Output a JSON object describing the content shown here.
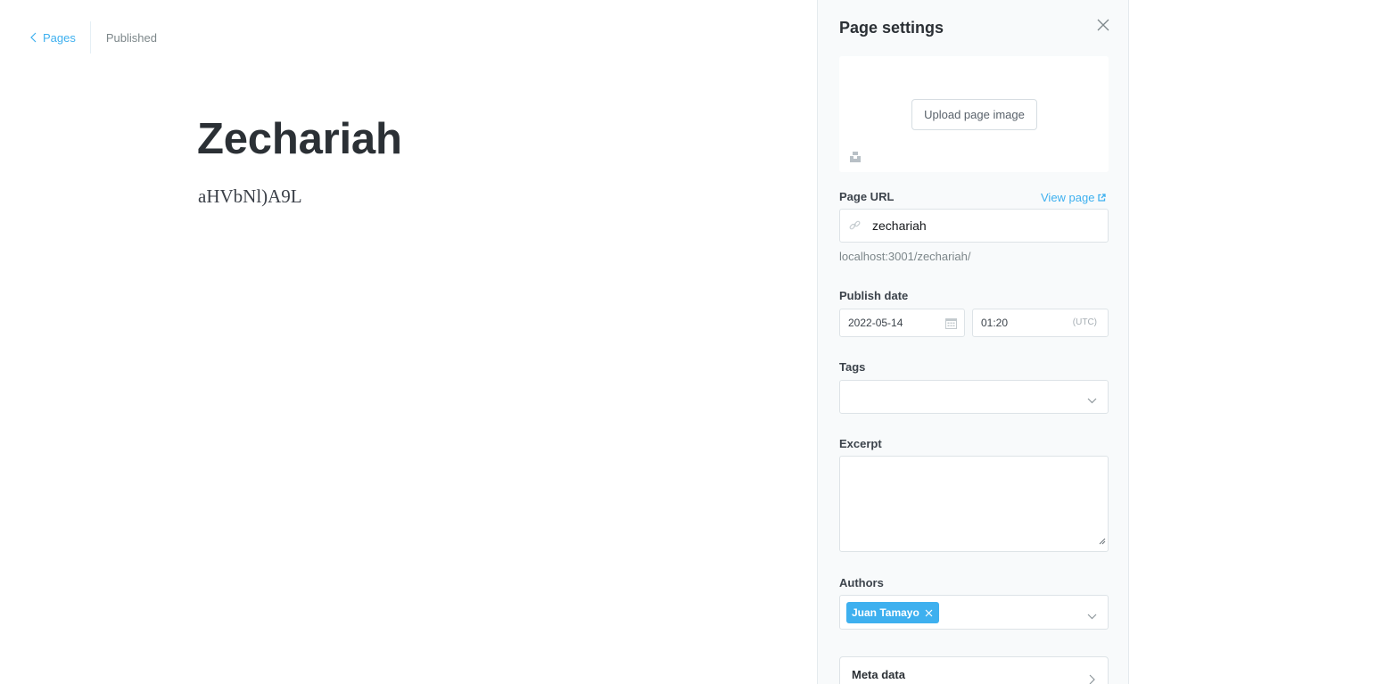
{
  "breadcrumb": {
    "back_label": "Pages",
    "status": "Published"
  },
  "editor": {
    "title": "Zechariah",
    "body": "aHVbNl)A9L"
  },
  "settings": {
    "title": "Page settings",
    "upload_image_label": "Upload page image",
    "page_url_label": "Page URL",
    "view_page_label": "View page",
    "slug": "zechariah",
    "url_hint": "localhost:3001/zechariah/",
    "publish_date_label": "Publish date",
    "publish_date": "2022-05-14",
    "publish_time": "01:20",
    "timezone": "(UTC)",
    "tags_label": "Tags",
    "tags_placeholder": "",
    "excerpt_label": "Excerpt",
    "excerpt_value": "",
    "authors_label": "Authors",
    "authors": [
      "Juan Tamayo"
    ],
    "meta_data_label": "Meta data"
  },
  "icons": {
    "back": "chevron-left-icon",
    "close": "close-icon",
    "unsplash": "unsplash-icon",
    "external": "external-link-icon",
    "link": "link-icon",
    "calendar": "calendar-icon",
    "dropdown": "chevron-down-icon",
    "remove": "remove-token-icon",
    "next": "chevron-right-icon"
  },
  "colors": {
    "accent": "#3eb0ef",
    "text": "#15171a",
    "muted": "#7d878a",
    "panel_bg": "#f8fafb",
    "border": "#dde3e7"
  }
}
